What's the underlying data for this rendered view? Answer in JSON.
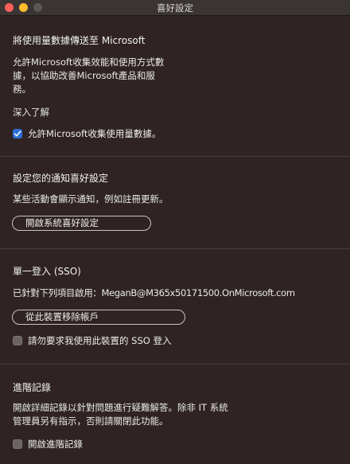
{
  "window": {
    "title": "喜好設定"
  },
  "telemetry": {
    "heading": "將使用量數據傳送至 Microsoft",
    "description": "允許Microsoft收集效能和使用方式數據，以協助改善Microsoft產品和服務。",
    "learn_more": "深入了解",
    "checkbox_label": "允許Microsoft收集使用量數據。",
    "checked": true
  },
  "notifications": {
    "heading": "設定您的通知喜好設定",
    "description": "某些活動會顯示通知，例如註冊更新。",
    "button": "開啟系統喜好設定"
  },
  "sso": {
    "heading": "單一登入 (SSO)",
    "enabled_for": "已針對下列項目啟用：MeganB@M365x50171500.OnMicrosoft.com",
    "remove_button": "從此裝置移除帳戶",
    "checkbox_label": "請勿要求我使用此裝置的 SSO 登入",
    "checked": false
  },
  "logging": {
    "heading": "進階記錄",
    "description": "開啟詳細記錄以針對問題進行疑難解答。除非 IT 系統管理員另有指示，否則請關閉此功能。",
    "checkbox_label": "開啟進階記錄",
    "checked": false
  }
}
